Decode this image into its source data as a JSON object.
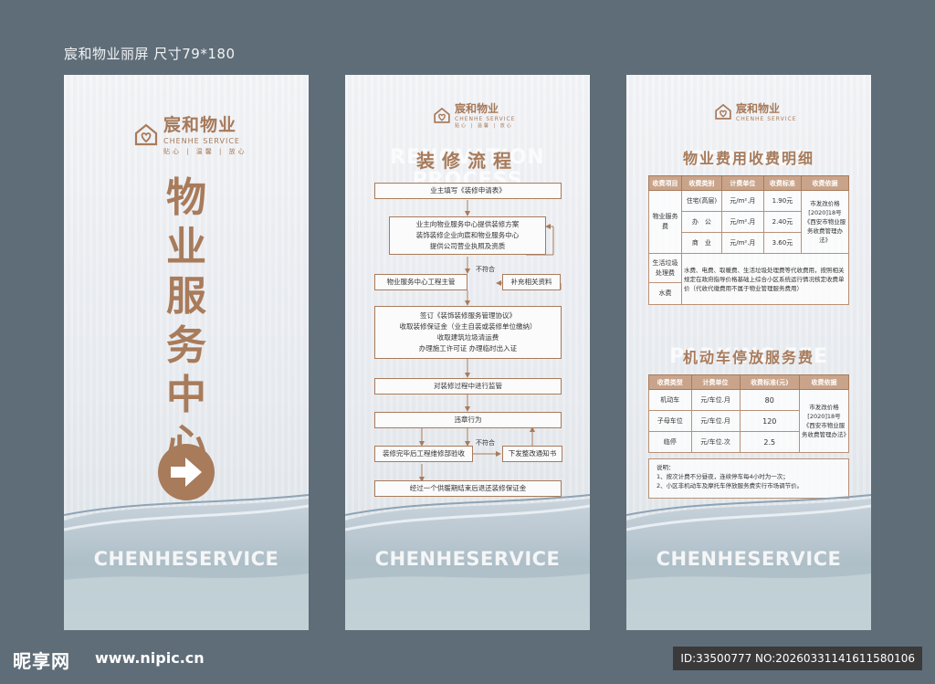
{
  "caption": "宸和物业丽屏 尺寸79*180",
  "brand": {
    "name": "宸和物业",
    "en": "CHENHE SERVICE",
    "tagline": "贴心 | 温馨 | 放心",
    "watermark": "CHENHESERVICE",
    "color": "#a87b5b"
  },
  "panel1": {
    "title_chars": [
      "物",
      "业",
      "服",
      "务",
      "中",
      "心"
    ],
    "arrow_icon": "arrow-right-icon"
  },
  "panel2": {
    "bg_word": "RENOVATION PROCESS",
    "title": "装修流程",
    "steps": {
      "s1": "业主填写《装修申请表》",
      "s2a": "业主向物业服务中心提供装修方案",
      "s2b": "装饰装修企业向宸和物业服务中心",
      "s2c": "提供公司营业执照及资质",
      "s3": "物业服务中心工程主管",
      "s3r": "补充相关资料",
      "s3label": "不符合",
      "s4a": "签订《装饰装修服务管理协议》",
      "s4b": "收取装修保证金（业主自装或装修单位缴纳）",
      "s4c": "收取建筑垃圾清运费",
      "s4d": "办理施工许可证 办理临时出入证",
      "s5": "对装修过程中进行监管",
      "s6": "违章行为",
      "s7": "装修完毕后工程维修部验收",
      "s7r": "下发整改通知书",
      "s7label": "不符合",
      "s8": "经过一个供暖期结束后退还装修保证金"
    }
  },
  "panel3": {
    "bg_word1": "SERVICES",
    "title1": "物业费用收费明细",
    "table1": {
      "headers": [
        "收费项目",
        "收费类别",
        "计费单位",
        "收费标准",
        "收费依据"
      ],
      "group1": "物业服务费",
      "rows": [
        {
          "cat": "住宅(高层)",
          "unit": "元/m².月",
          "price": "1.90元"
        },
        {
          "cat": "办　公",
          "unit": "元/m².月",
          "price": "2.40元"
        },
        {
          "cat": "商　业",
          "unit": "元/m².月",
          "price": "3.60元"
        }
      ],
      "basis": "市发改价格[2020]18号《西安市物业服务收费管理办法》",
      "garbage": "生活垃圾处理费",
      "water": "水费",
      "note": "水费、电费、取暖费、生活垃圾处理费等代收费用，按照相关规定在政府指导价格基础上综合小区系统运行情况核定收费单价（代收代缴费用不属于物业管理服务费用）"
    },
    "bg_word2": "PARKING FEE",
    "title2": "机动车停放服务费",
    "table2": {
      "headers": [
        "收费类型",
        "计费单位",
        "收费标准(元)",
        "收费依据"
      ],
      "rows": [
        {
          "type": "机动车",
          "unit": "元/车位.月",
          "price": "80"
        },
        {
          "type": "子母车位",
          "unit": "元/车位.月",
          "price": "120"
        },
        {
          "type": "临停",
          "unit": "元/车位.次",
          "price": "2.5"
        }
      ],
      "basis": "市发改价格[2020]18号《西安市物业服务收费管理办法》"
    },
    "notes_title": "说明：",
    "notes": [
      "1、按次计费不分昼夜，连续停车每4小时为一次；",
      "2、小区非机动车及摩托车停放服务费实行市场调节价。"
    ]
  },
  "footer": {
    "site_logo": "昵享网",
    "site_url": "www.nipic.cn",
    "id_text": "ID:33500777 NO:20260331141611580106"
  }
}
